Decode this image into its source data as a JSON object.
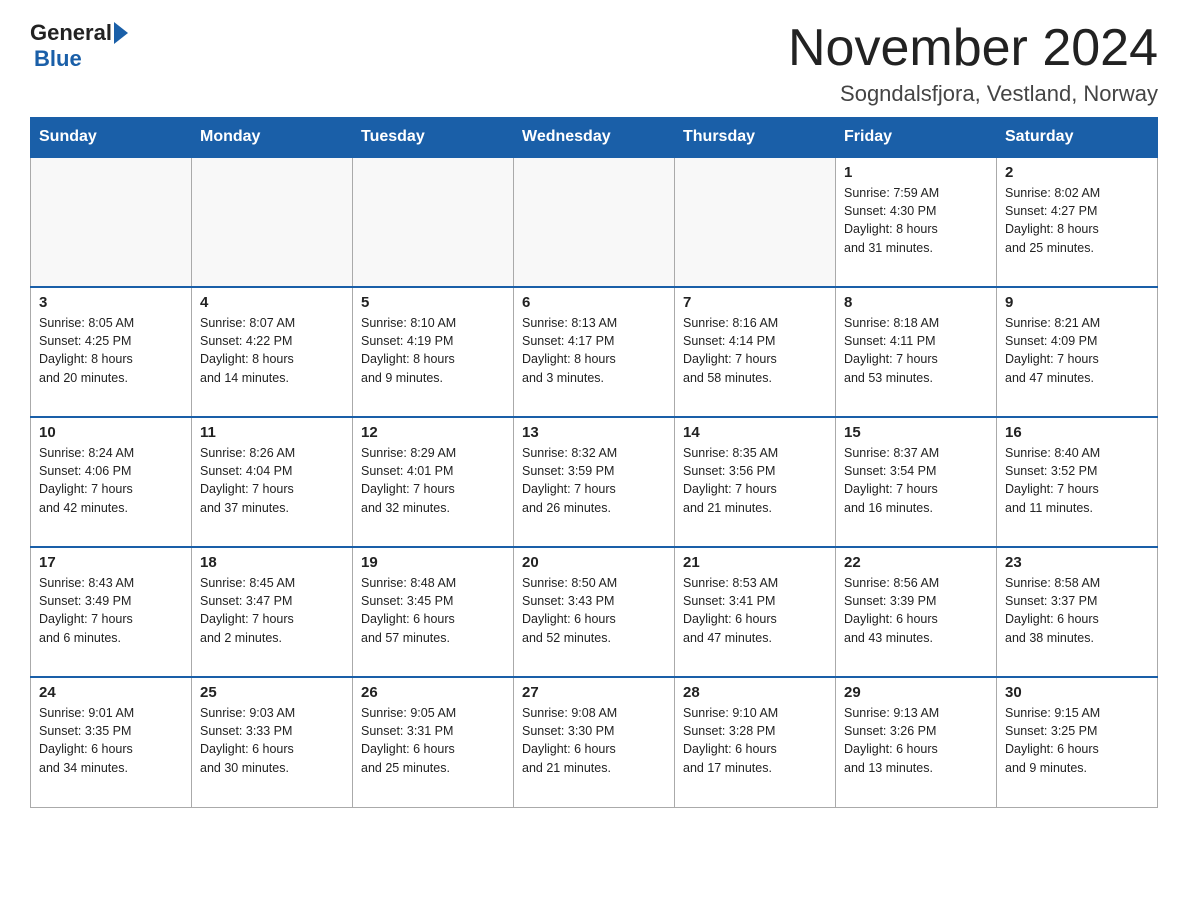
{
  "header": {
    "logo_general": "General",
    "logo_blue": "Blue",
    "title": "November 2024",
    "subtitle": "Sogndalsfjora, Vestland, Norway"
  },
  "calendar": {
    "days_of_week": [
      "Sunday",
      "Monday",
      "Tuesday",
      "Wednesday",
      "Thursday",
      "Friday",
      "Saturday"
    ],
    "weeks": [
      [
        {
          "day": "",
          "info": ""
        },
        {
          "day": "",
          "info": ""
        },
        {
          "day": "",
          "info": ""
        },
        {
          "day": "",
          "info": ""
        },
        {
          "day": "",
          "info": ""
        },
        {
          "day": "1",
          "info": "Sunrise: 7:59 AM\nSunset: 4:30 PM\nDaylight: 8 hours\nand 31 minutes."
        },
        {
          "day": "2",
          "info": "Sunrise: 8:02 AM\nSunset: 4:27 PM\nDaylight: 8 hours\nand 25 minutes."
        }
      ],
      [
        {
          "day": "3",
          "info": "Sunrise: 8:05 AM\nSunset: 4:25 PM\nDaylight: 8 hours\nand 20 minutes."
        },
        {
          "day": "4",
          "info": "Sunrise: 8:07 AM\nSunset: 4:22 PM\nDaylight: 8 hours\nand 14 minutes."
        },
        {
          "day": "5",
          "info": "Sunrise: 8:10 AM\nSunset: 4:19 PM\nDaylight: 8 hours\nand 9 minutes."
        },
        {
          "day": "6",
          "info": "Sunrise: 8:13 AM\nSunset: 4:17 PM\nDaylight: 8 hours\nand 3 minutes."
        },
        {
          "day": "7",
          "info": "Sunrise: 8:16 AM\nSunset: 4:14 PM\nDaylight: 7 hours\nand 58 minutes."
        },
        {
          "day": "8",
          "info": "Sunrise: 8:18 AM\nSunset: 4:11 PM\nDaylight: 7 hours\nand 53 minutes."
        },
        {
          "day": "9",
          "info": "Sunrise: 8:21 AM\nSunset: 4:09 PM\nDaylight: 7 hours\nand 47 minutes."
        }
      ],
      [
        {
          "day": "10",
          "info": "Sunrise: 8:24 AM\nSunset: 4:06 PM\nDaylight: 7 hours\nand 42 minutes."
        },
        {
          "day": "11",
          "info": "Sunrise: 8:26 AM\nSunset: 4:04 PM\nDaylight: 7 hours\nand 37 minutes."
        },
        {
          "day": "12",
          "info": "Sunrise: 8:29 AM\nSunset: 4:01 PM\nDaylight: 7 hours\nand 32 minutes."
        },
        {
          "day": "13",
          "info": "Sunrise: 8:32 AM\nSunset: 3:59 PM\nDaylight: 7 hours\nand 26 minutes."
        },
        {
          "day": "14",
          "info": "Sunrise: 8:35 AM\nSunset: 3:56 PM\nDaylight: 7 hours\nand 21 minutes."
        },
        {
          "day": "15",
          "info": "Sunrise: 8:37 AM\nSunset: 3:54 PM\nDaylight: 7 hours\nand 16 minutes."
        },
        {
          "day": "16",
          "info": "Sunrise: 8:40 AM\nSunset: 3:52 PM\nDaylight: 7 hours\nand 11 minutes."
        }
      ],
      [
        {
          "day": "17",
          "info": "Sunrise: 8:43 AM\nSunset: 3:49 PM\nDaylight: 7 hours\nand 6 minutes."
        },
        {
          "day": "18",
          "info": "Sunrise: 8:45 AM\nSunset: 3:47 PM\nDaylight: 7 hours\nand 2 minutes."
        },
        {
          "day": "19",
          "info": "Sunrise: 8:48 AM\nSunset: 3:45 PM\nDaylight: 6 hours\nand 57 minutes."
        },
        {
          "day": "20",
          "info": "Sunrise: 8:50 AM\nSunset: 3:43 PM\nDaylight: 6 hours\nand 52 minutes."
        },
        {
          "day": "21",
          "info": "Sunrise: 8:53 AM\nSunset: 3:41 PM\nDaylight: 6 hours\nand 47 minutes."
        },
        {
          "day": "22",
          "info": "Sunrise: 8:56 AM\nSunset: 3:39 PM\nDaylight: 6 hours\nand 43 minutes."
        },
        {
          "day": "23",
          "info": "Sunrise: 8:58 AM\nSunset: 3:37 PM\nDaylight: 6 hours\nand 38 minutes."
        }
      ],
      [
        {
          "day": "24",
          "info": "Sunrise: 9:01 AM\nSunset: 3:35 PM\nDaylight: 6 hours\nand 34 minutes."
        },
        {
          "day": "25",
          "info": "Sunrise: 9:03 AM\nSunset: 3:33 PM\nDaylight: 6 hours\nand 30 minutes."
        },
        {
          "day": "26",
          "info": "Sunrise: 9:05 AM\nSunset: 3:31 PM\nDaylight: 6 hours\nand 25 minutes."
        },
        {
          "day": "27",
          "info": "Sunrise: 9:08 AM\nSunset: 3:30 PM\nDaylight: 6 hours\nand 21 minutes."
        },
        {
          "day": "28",
          "info": "Sunrise: 9:10 AM\nSunset: 3:28 PM\nDaylight: 6 hours\nand 17 minutes."
        },
        {
          "day": "29",
          "info": "Sunrise: 9:13 AM\nSunset: 3:26 PM\nDaylight: 6 hours\nand 13 minutes."
        },
        {
          "day": "30",
          "info": "Sunrise: 9:15 AM\nSunset: 3:25 PM\nDaylight: 6 hours\nand 9 minutes."
        }
      ]
    ]
  }
}
